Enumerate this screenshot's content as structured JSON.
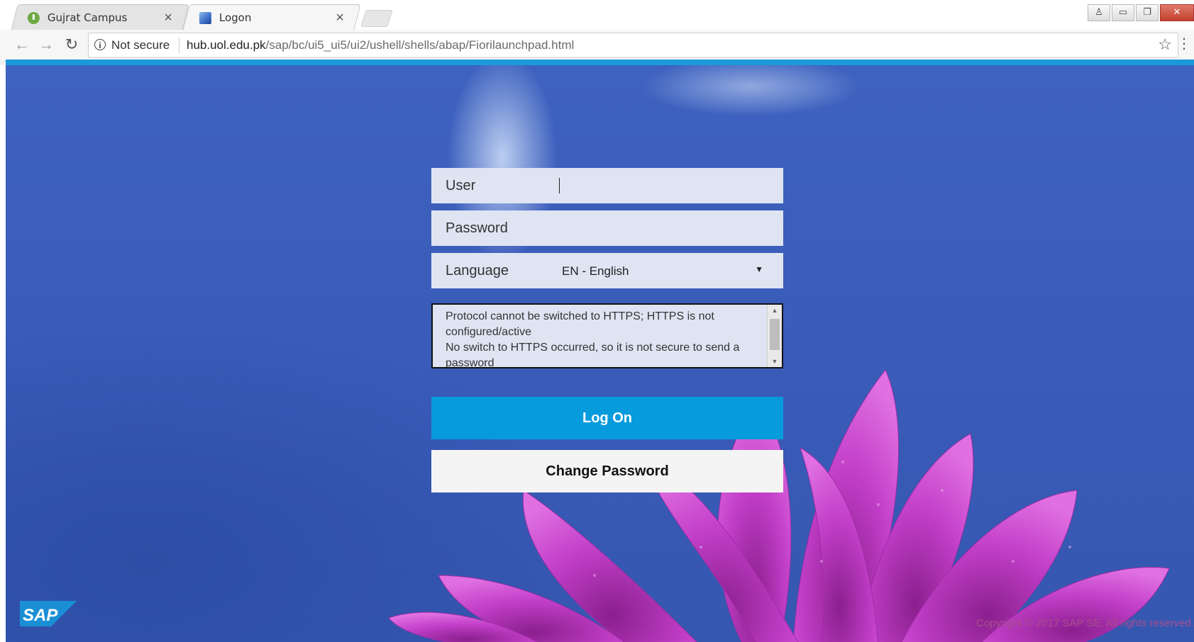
{
  "browser": {
    "tabs": [
      {
        "title": "Gujrat Campus",
        "icon": "green-leaf-icon",
        "active": false
      },
      {
        "title": "Logon",
        "icon": "sap-page-icon",
        "active": true
      }
    ],
    "security_label": "Not secure",
    "url_host": "hub.uol.edu.pk",
    "url_path": "/sap/bc/ui5_ui5/ui2/ushell/shells/abap/Fiorilaunchpad.html",
    "window_controls": [
      "user-icon",
      "minimize-icon",
      "restore-icon",
      "close-icon"
    ]
  },
  "login": {
    "user_label": "User",
    "user_value": "",
    "password_label": "Password",
    "password_value": "",
    "language_label": "Language",
    "language_value": "EN - English",
    "message_lines": [
      "Protocol cannot be switched to HTTPS; HTTPS is not configured/active",
      "No switch to HTTPS occurred, so it is not secure to send a password"
    ],
    "logon_button": "Log On",
    "change_password_button": "Change Password"
  },
  "footer": {
    "logo": "SAP",
    "copyright": "Copyright © 2017 SAP SE. All rights reserved."
  },
  "colors": {
    "accent": "#1a9ad9",
    "logon_button": "#069bdc",
    "background": "#3a5cb9",
    "flower": "#c23fc8"
  }
}
